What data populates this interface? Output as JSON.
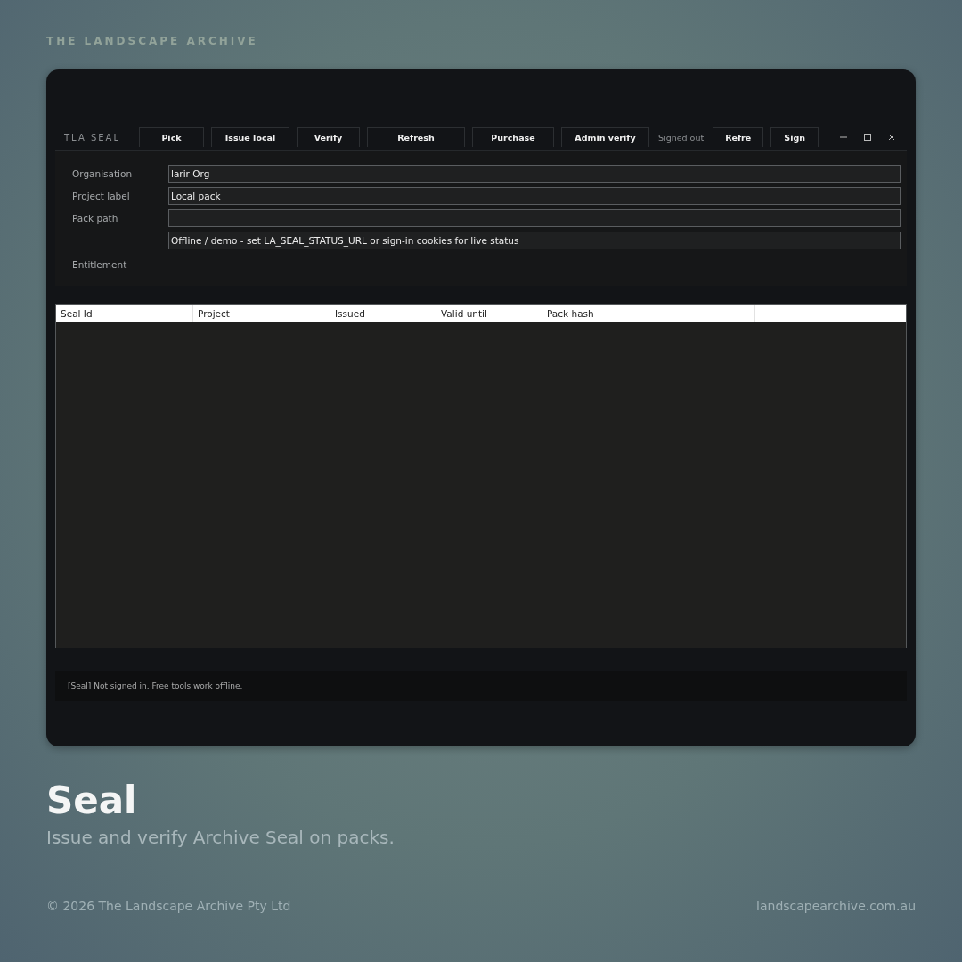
{
  "brand": "THE LANDSCAPE ARCHIVE",
  "window": {
    "title": "TLA SEAL",
    "toolbar": [
      {
        "kind": "button",
        "label": "Pick"
      },
      {
        "kind": "button",
        "label": "Issue local"
      },
      {
        "kind": "button",
        "label": "Verify"
      },
      {
        "kind": "button",
        "label": "Refresh"
      },
      {
        "kind": "button",
        "label": "Purchase"
      },
      {
        "kind": "button",
        "label": "Admin verify"
      },
      {
        "kind": "status",
        "label": "Signed out"
      },
      {
        "kind": "button",
        "label": "Refre"
      },
      {
        "kind": "button",
        "label": "Sign"
      }
    ],
    "form": {
      "fields": [
        {
          "label": "Organisation",
          "value": "larir Org"
        },
        {
          "label": "Project label",
          "value": "Local pack"
        },
        {
          "label": "Pack path"
        },
        {
          "value": "Offline / demo - set LA_SEAL_STATUS_URL or sign-in cookies for live status"
        }
      ],
      "entitlement_label": "Entitlement"
    },
    "table": {
      "columns": [
        "Seal Id",
        "Project",
        "Issued",
        "Valid until",
        "Pack hash"
      ]
    },
    "status_bar": "[Seal] Not signed in. Free tools work offline."
  },
  "headline": "Seal",
  "tagline": "Issue and verify Archive Seal on packs.",
  "footer": {
    "copyright": "© 2026 The Landscape Archive Pty Ltd",
    "website": "landscapearchive.com.au"
  }
}
